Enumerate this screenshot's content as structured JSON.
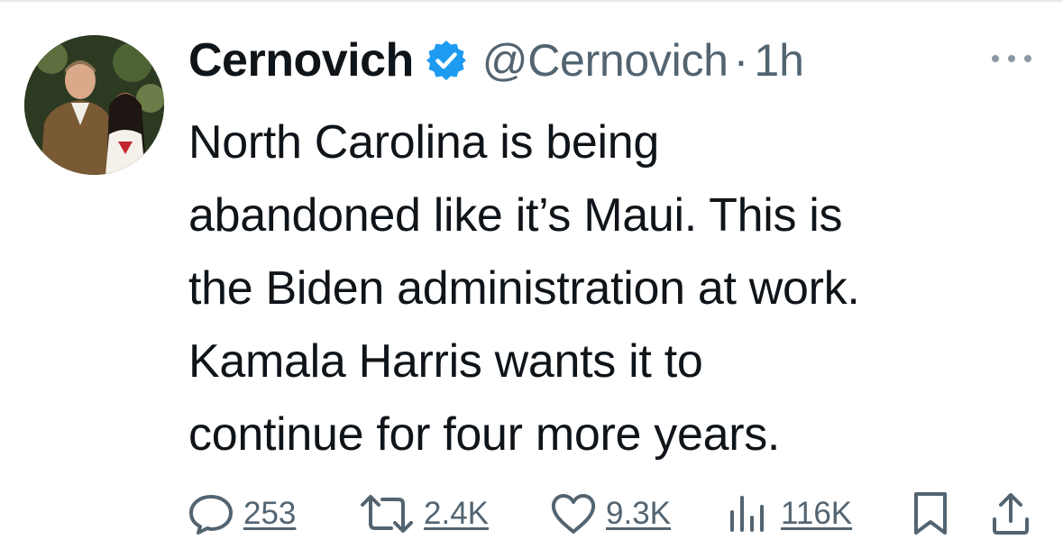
{
  "author": {
    "name": "Cernovich",
    "handle": "@Cernovich",
    "separator": "·",
    "time": "1h",
    "verified": true,
    "avatar_icon": "avatar-photo"
  },
  "tweet": {
    "lines": [
      "North Carolina is being",
      "abandoned like it’s Maui. This is",
      "the Biden administration at work.",
      "Kamala Harris wants it to",
      "continue for four more years."
    ]
  },
  "actions": {
    "replies": "253",
    "retweets": "2.4K",
    "likes": "9.3K",
    "views": "116K"
  },
  "colors": {
    "text": "#0f1419",
    "secondary": "#536471",
    "verified": "#1d9bf0"
  }
}
